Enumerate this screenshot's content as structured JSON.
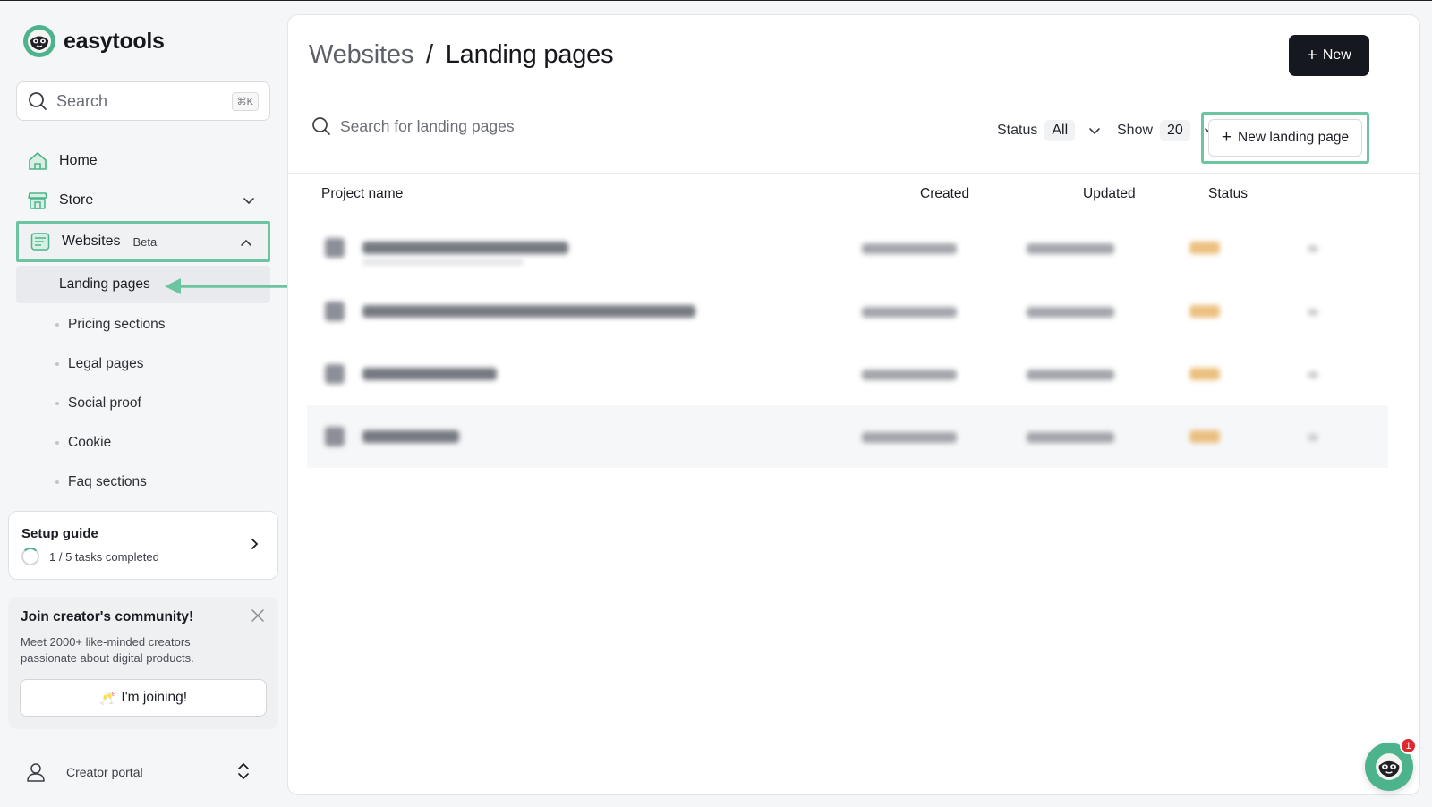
{
  "brand": {
    "name": "easytools"
  },
  "sidebar": {
    "search_placeholder": "Search",
    "search_shortcut": "⌘K",
    "nav": {
      "home": "Home",
      "store": "Store",
      "websites": "Websites",
      "websites_badge": "Beta"
    },
    "sub_items": {
      "landing": "Landing pages",
      "pricing": "Pricing sections",
      "legal": "Legal pages",
      "social": "Social proof",
      "cookie": "Cookie",
      "faq": "Faq sections"
    },
    "setup": {
      "title": "Setup guide",
      "progress": "1 / 5 tasks completed",
      "completed": 1,
      "total": 5
    },
    "community": {
      "title": "Join creator's community!",
      "description": "Meet 2000+ like-minded creators passionate about digital products.",
      "button": "I'm joining!"
    },
    "portal": "Creator portal"
  },
  "main": {
    "breadcrumb": {
      "parent": "Websites",
      "separator": "/",
      "current": "Landing pages"
    },
    "new_button": "New",
    "search_placeholder": "Search for landing pages",
    "status_label": "Status",
    "status_value": "All",
    "show_label": "Show",
    "show_value": "20",
    "new_landing_button": "New landing page",
    "columns": {
      "project": "Project name",
      "created": "Created",
      "updated": "Updated",
      "status": "Status"
    }
  },
  "chat": {
    "badge": "1"
  },
  "colors": {
    "accent": "#4cb38c",
    "highlight": "#6cc4a0",
    "primary_button": "#15181f",
    "badge": "#e0282f"
  }
}
